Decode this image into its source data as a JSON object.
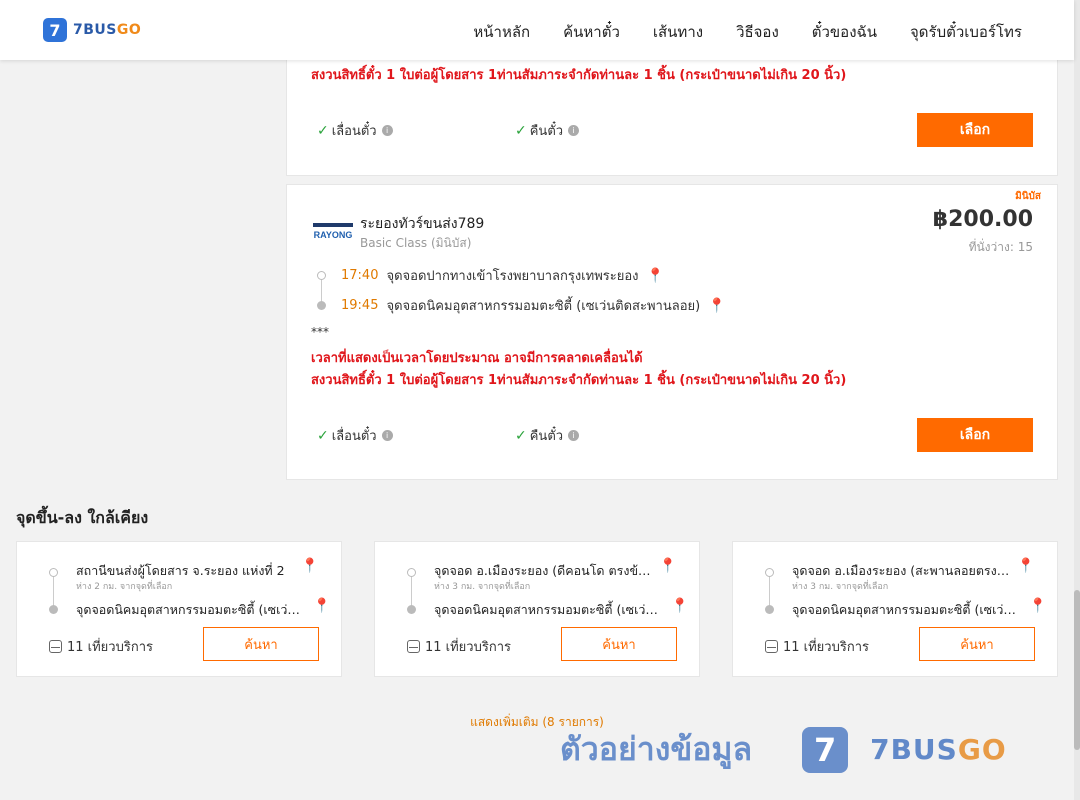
{
  "header": {
    "logo_mark": "7",
    "logo_prefix": "7BUS",
    "logo_suffix": "GO",
    "nav": [
      "หน้าหลัก",
      "ค้นหาตั๋ว",
      "เส้นทาง",
      "วิธีจอง",
      "ตั๋วของฉัน",
      "จุดรับตั๋วเบอร์โทร"
    ]
  },
  "card1": {
    "note": "สงวนสิทธิ์ตั๋ว 1 ใบต่อผู้โดยสาร 1ท่านสัมภาระจำกัดท่านละ 1 ชิ้น (กระเป๋าขนาดไม่เกิน 20 นิ้ว)",
    "feature_reschedule": "เลื่อนตั๋ว",
    "feature_refund": "คืนตั๋ว",
    "select_label": "เลือก"
  },
  "card2": {
    "badge": "มินิบัส",
    "operator_logo": "RAYONG",
    "operator": "ระยองทัวร์ขนส่ง789",
    "class": "Basic Class (มินิบัส)",
    "price": "฿200.00",
    "seats": "ที่นั่งว่าง: 15",
    "stops": [
      {
        "time": "17:40",
        "name": "จุดจอดปากทางเข้าโรงพยาบาลกรุงเทพระยอง"
      },
      {
        "time": "19:45",
        "name": "จุดจอดนิคมอุตสาหกรรมอมตะซิตี้ (เซเว่นติดสะพานลอย)"
      }
    ],
    "stars": "***",
    "note1": "เวลาที่แสดงเป็นเวลาโดยประมาณ อาจมีการคลาดเคลื่อนได้",
    "note2": "สงวนสิทธิ์ตั๋ว 1 ใบต่อผู้โดยสาร 1ท่านสัมภาระจำกัดท่านละ 1 ชิ้น (กระเป๋าขนาดไม่เกิน 20 นิ้ว)",
    "feature_reschedule": "เลื่อนตั๋ว",
    "feature_refund": "คืนตั๋ว",
    "select_label": "เลือก"
  },
  "nearby": {
    "title": "จุดขึ้น-ลง ใกล้เคียง",
    "items": [
      {
        "from": "สถานีขนส่งผู้โดยสาร จ.ระยอง แห่งที่ 2",
        "distance": "ห่าง 2 กม. จากจุดที่เลือก",
        "to": "จุดจอดนิคมอุตสาหกรรมอมตะซิตี้ (เซเว่นติดสะพานลอย)",
        "trips": "11 เที่ยวบริการ",
        "search_label": "ค้นหา"
      },
      {
        "from": "จุดจอด อ.เมืองระยอง (ดีคอนโด ตรงข้ามตลาด)",
        "distance": "ห่าง 3 กม. จากจุดที่เลือก",
        "to": "จุดจอดนิคมอุตสาหกรรมอมตะซิตี้ (เซเว่นติดสะพานลอย)",
        "trips": "11 เที่ยวบริการ",
        "search_label": "ค้นหา"
      },
      {
        "from": "จุดจอด อ.เมืองระยอง (สะพานลอยตรงข้ามห้าง)",
        "distance": "ห่าง 3 กม. จากจุดที่เลือก",
        "to": "จุดจอดนิคมอุตสาหกรรมอมตะซิตี้ (เซเว่นติดสะพานลอย)",
        "trips": "11 เที่ยวบริการ",
        "search_label": "ค้นหา"
      }
    ],
    "show_more": "แสดงเพิ่มเติม (8 รายการ)"
  },
  "watermark": {
    "text": "ตัวอย่างข้อมูล",
    "logo_mark": "7",
    "brand_prefix": "7BUS",
    "brand_suffix": "GO"
  },
  "colors": {
    "accent": "#ff6a00",
    "warning": "#e0161b",
    "brand": "#2f73d8",
    "check": "#2aa33b"
  }
}
